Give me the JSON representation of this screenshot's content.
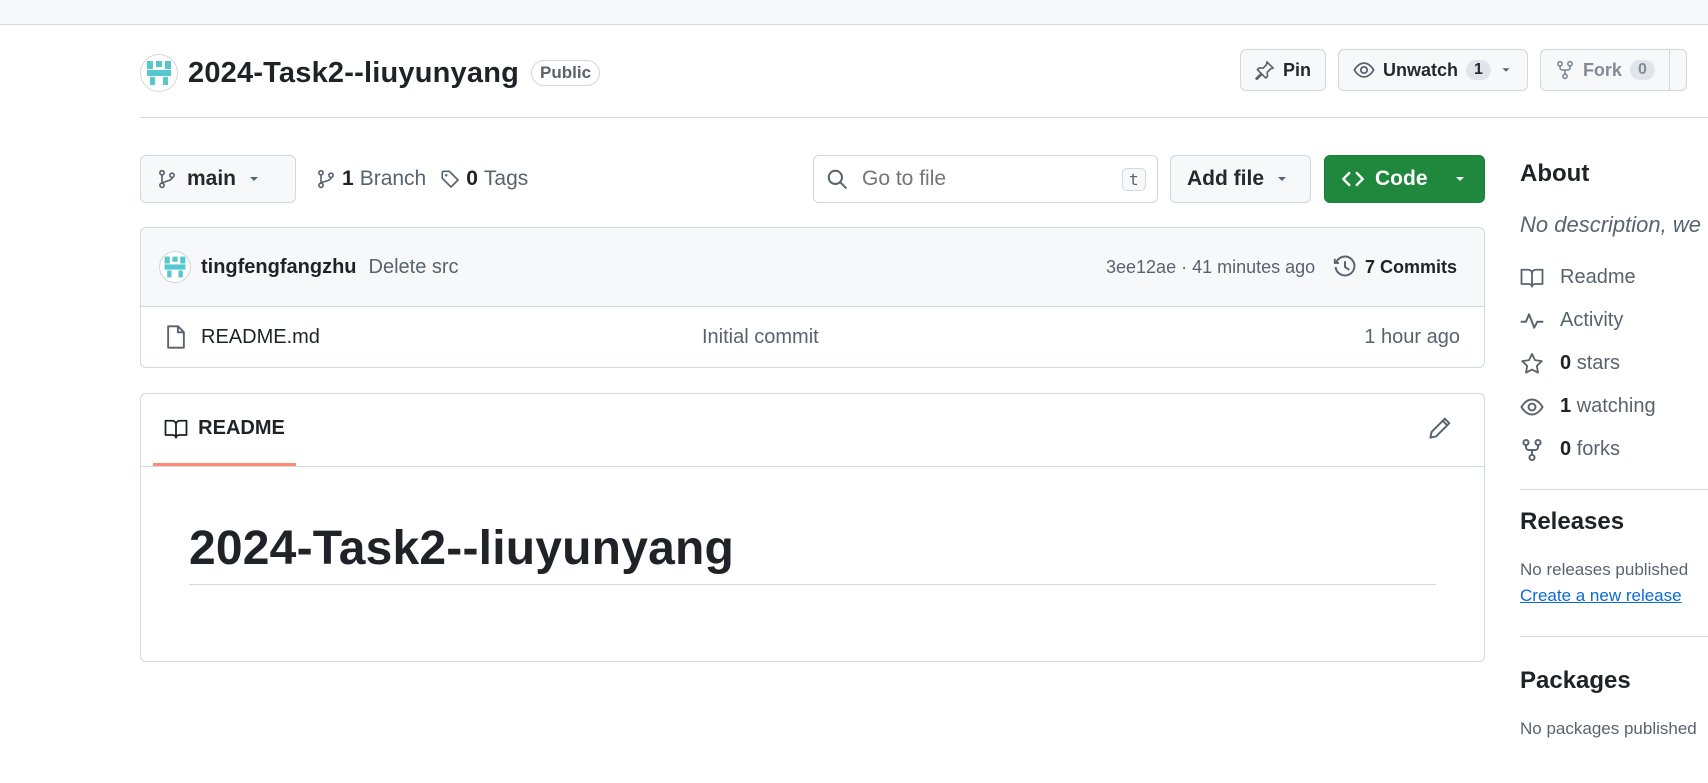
{
  "repo": {
    "name": "2024-Task2--liuyunyang",
    "visibility": "Public"
  },
  "header_actions": {
    "pin_label": "Pin",
    "unwatch_label": "Unwatch",
    "unwatch_count": "1",
    "fork_label": "Fork",
    "fork_count": "0"
  },
  "toolbar": {
    "branch": "main",
    "branches_count": "1",
    "branches_label": "Branch",
    "tags_count": "0",
    "tags_label": "Tags",
    "search_placeholder": "Go to file",
    "search_shortcut": "t",
    "add_file_label": "Add file",
    "code_label": "Code"
  },
  "latest_commit": {
    "author": "tingfengfangzhu",
    "message": "Delete src",
    "meta": "3ee12ae · 41 minutes ago",
    "commits_label": "7 Commits"
  },
  "files": [
    {
      "name": "README.md",
      "commit_message": "Initial commit",
      "age": "1 hour ago"
    }
  ],
  "readme": {
    "tab_label": "README",
    "heading": "2024-Task2--liuyunyang"
  },
  "sidebar": {
    "about_title": "About",
    "description": "No description, we",
    "items": [
      {
        "icon": "book-icon",
        "count": "",
        "label": "Readme"
      },
      {
        "icon": "pulse-icon",
        "count": "",
        "label": "Activity"
      },
      {
        "icon": "star-icon",
        "count": "0",
        "label": "stars"
      },
      {
        "icon": "eye-icon",
        "count": "1",
        "label": "watching"
      },
      {
        "icon": "fork-icon",
        "count": "0",
        "label": "forks"
      }
    ],
    "releases_title": "Releases",
    "releases_note": "No releases published",
    "releases_link": "Create a new release",
    "packages_title": "Packages",
    "packages_note": "No packages published"
  },
  "colors": {
    "code_button": "#1f883d",
    "readme_tab_underline": "#fd8c73",
    "link": "#0969da"
  }
}
